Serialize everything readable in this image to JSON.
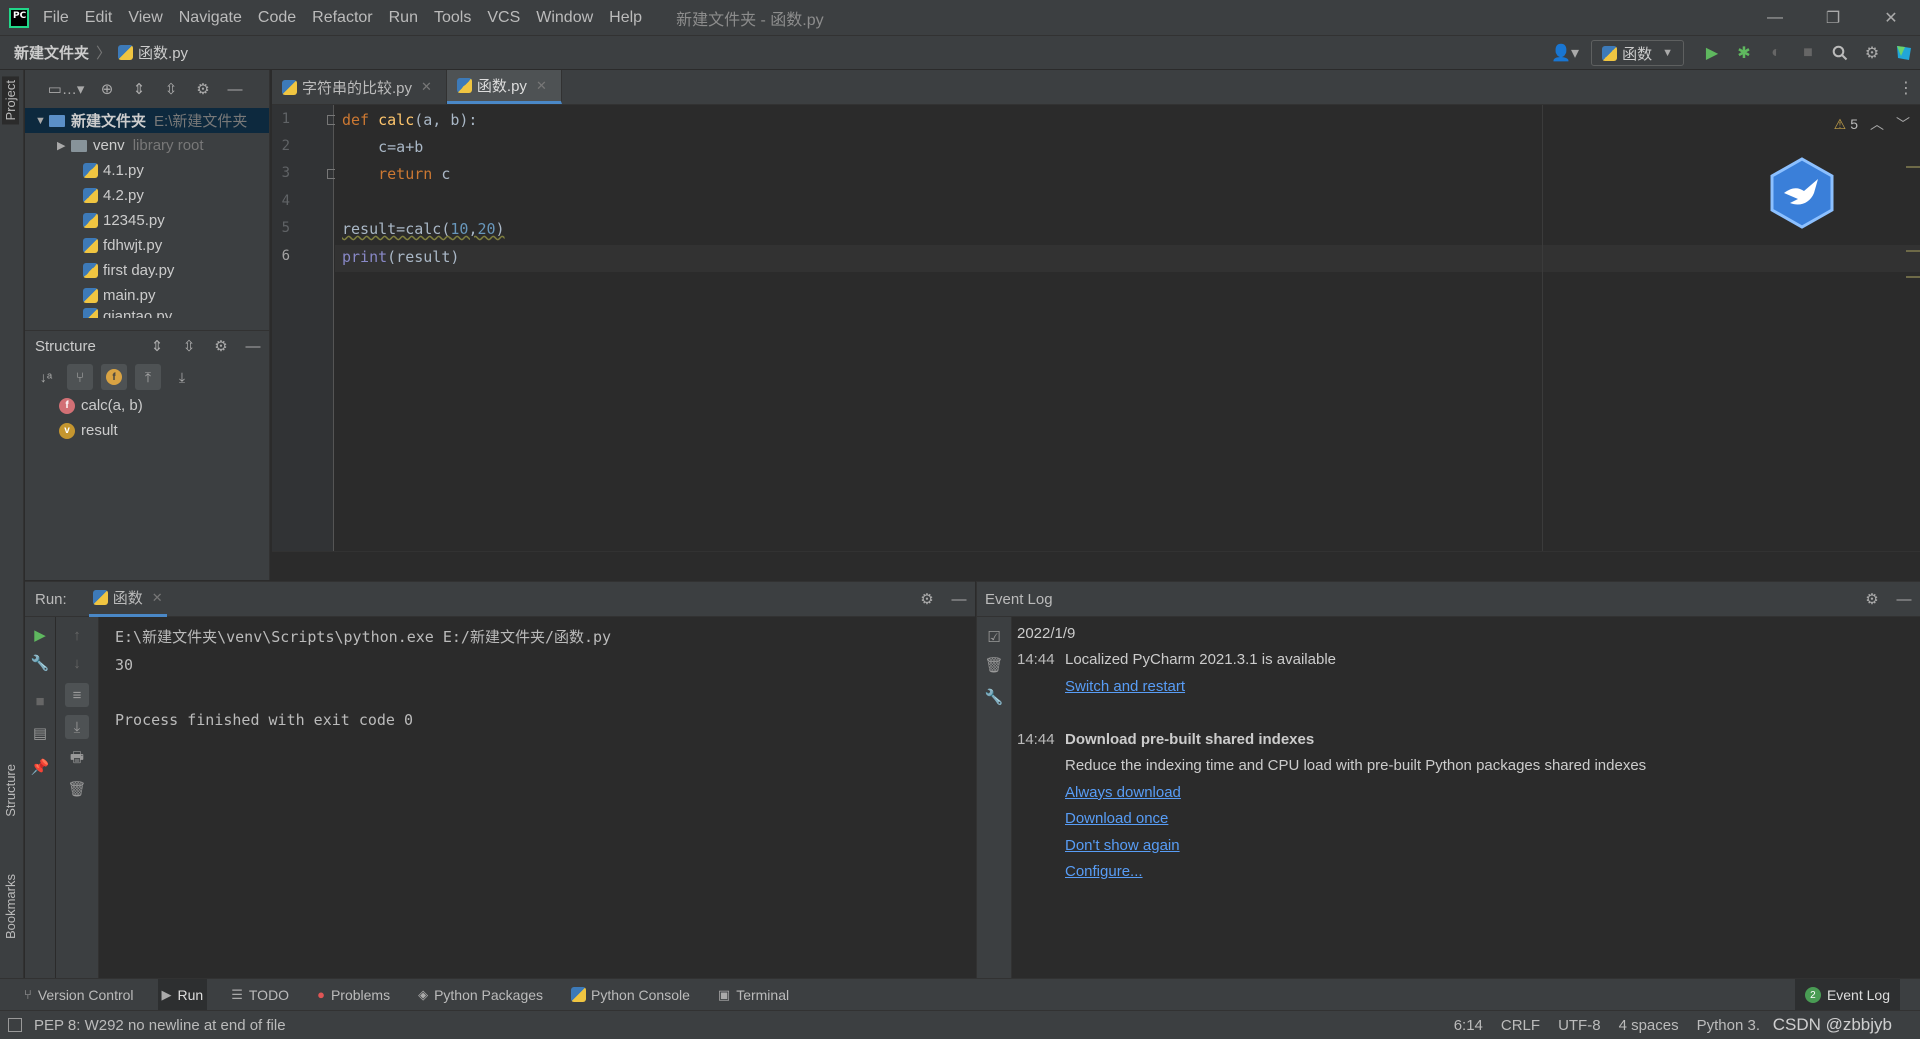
{
  "menubar": {
    "items": [
      "File",
      "Edit",
      "View",
      "Navigate",
      "Code",
      "Refactor",
      "Run",
      "Tools",
      "VCS",
      "Window",
      "Help"
    ],
    "window_title": "新建文件夹 - 函数.py"
  },
  "navbar": {
    "breadcrumb_root": "新建文件夹",
    "breadcrumb_file": "函数.py",
    "run_config": "函数"
  },
  "left_stripe": {
    "project": "Project",
    "structure": "Structure",
    "bookmarks": "Bookmarks"
  },
  "project": {
    "root_name": "新建文件夹",
    "root_path": "E:\\新建文件夹",
    "venv": "venv",
    "venv_hint": "library root",
    "files": [
      "4.1.py",
      "4.2.py",
      "12345.py",
      "fdhwjt.py",
      "first day.py",
      "main.py",
      "qiantao.py"
    ]
  },
  "structure": {
    "title": "Structure",
    "items": [
      {
        "label": "calc(a, b)",
        "kind": "f"
      },
      {
        "label": "result",
        "kind": "v"
      }
    ]
  },
  "editor": {
    "tabs": [
      "字符串的比较.py",
      "函数.py"
    ],
    "line_numbers": [
      "1",
      "2",
      "3",
      "4",
      "5",
      "6"
    ],
    "warnings_count": "5",
    "code": {
      "l1_def": "def",
      "l1_name": "calc",
      "l1_rest": "(a, b):",
      "l2": "    c=a+b",
      "l3_kw": "return",
      "l3_rest": " c",
      "l5_a": "result=calc(",
      "l5_n1": "10",
      "l5_comma": ",",
      "l5_n2": "20",
      "l5_b": ")",
      "l6_fn": "print",
      "l6_rest": "(result)"
    }
  },
  "run": {
    "label": "Run:",
    "tab": "函数",
    "console": "E:\\新建文件夹\\venv\\Scripts\\python.exe E:/新建文件夹/函数.py\n30\n\nProcess finished with exit code 0"
  },
  "event_log": {
    "title": "Event Log",
    "date": "2022/1/9",
    "e1_time": "14:44",
    "e1_text": "Localized PyCharm 2021.3.1 is available",
    "e1_link": "Switch and restart",
    "e2_time": "14:44",
    "e2_title": "Download pre-built shared indexes",
    "e2_text": "Reduce the indexing time and CPU load with pre-built Python packages shared indexes",
    "e2_links": [
      "Always download",
      "Download once",
      "Don't show again",
      "Configure..."
    ]
  },
  "tool_strip": {
    "items": [
      "Version Control",
      "Run",
      "TODO",
      "Problems",
      "Python Packages",
      "Python Console",
      "Terminal"
    ],
    "event_log": "Event Log",
    "event_log_count": "2"
  },
  "status_bar": {
    "message": "PEP 8: W292 no newline at end of file",
    "position": "6:14",
    "line_sep": "CRLF",
    "encoding": "UTF-8",
    "indent": "4 spaces",
    "interpreter": "Python 3.",
    "watermark": "CSDN @zbbjyb"
  }
}
